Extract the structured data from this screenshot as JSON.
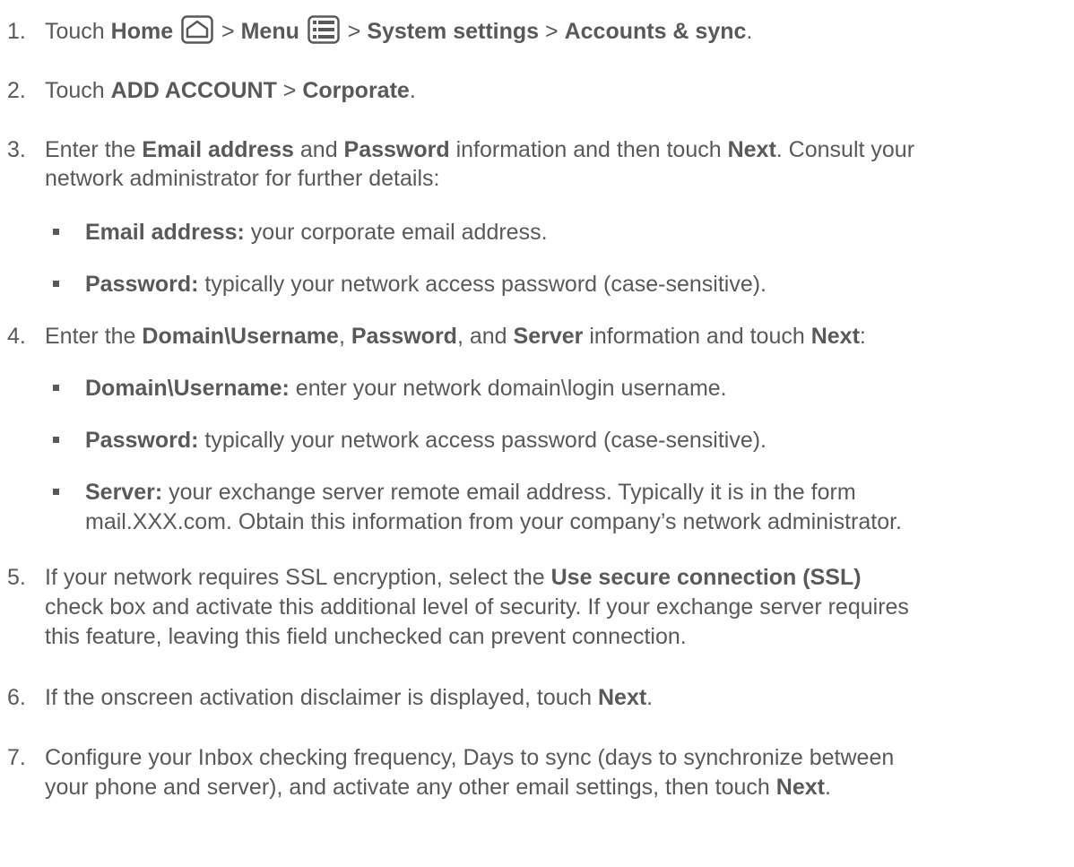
{
  "steps": [
    {
      "num": "1.",
      "parts": [
        {
          "t": "Touch "
        },
        {
          "b": "Home"
        },
        {
          "t": " "
        },
        {
          "icon": "home-icon"
        },
        {
          "t": " > "
        },
        {
          "b": "Menu"
        },
        {
          "t": " "
        },
        {
          "icon": "menu-icon"
        },
        {
          "t": " > "
        },
        {
          "b": "System settings"
        },
        {
          "t": " > "
        },
        {
          "b": "Accounts & sync"
        },
        {
          "t": "."
        }
      ]
    },
    {
      "num": "2.",
      "parts": [
        {
          "t": "Touch "
        },
        {
          "b": "ADD ACCOUNT"
        },
        {
          "t": " > "
        },
        {
          "b": "Corporate"
        },
        {
          "t": "."
        }
      ]
    },
    {
      "num": "3.",
      "lines": [
        [
          {
            "t": "Enter the "
          },
          {
            "b": "Email address"
          },
          {
            "t": " and "
          },
          {
            "b": "Password"
          },
          {
            "t": " information and then touch "
          },
          {
            "b": "Next"
          },
          {
            "t": ". Consult your"
          }
        ],
        [
          {
            "t": "network administrator for further details:"
          }
        ]
      ],
      "subs": [
        [
          {
            "b": "Email address:"
          },
          {
            "t": " your corporate email address."
          }
        ],
        [
          {
            "b": "Password:"
          },
          {
            "t": " typically your network access password (case-sensitive)."
          }
        ]
      ]
    },
    {
      "num": "4.",
      "parts": [
        {
          "t": "Enter the "
        },
        {
          "b": "Domain\\Username"
        },
        {
          "t": ", "
        },
        {
          "b": "Password"
        },
        {
          "t": ", and "
        },
        {
          "b": "Server"
        },
        {
          "t": " information and touch "
        },
        {
          "b": "Next"
        },
        {
          "t": ":"
        }
      ],
      "subs": [
        [
          {
            "b": "Domain\\Username:"
          },
          {
            "t": " enter your network domain\\login username."
          }
        ],
        [
          {
            "b": "Password:"
          },
          {
            "t": " typically your network access password (case-sensitive)."
          }
        ],
        [
          {
            "b": "Server:"
          },
          {
            "t": " your exchange server remote email address. Typically it is in the form"
          }
        ],
        [
          {
            "t": "mail.XXX.com. Obtain this information from your company’s network administrator."
          }
        ]
      ]
    },
    {
      "num": "5.",
      "lines": [
        [
          {
            "t": "If your network requires SSL encryption, select the "
          },
          {
            "b": "Use secure connection (SSL)"
          }
        ],
        [
          {
            "t": "check box and activate this additional level of security. If your exchange server requires"
          }
        ],
        [
          {
            "t": "this feature, leaving this field unchecked can prevent connection."
          }
        ]
      ]
    },
    {
      "num": "6.",
      "parts": [
        {
          "t": "If the onscreen activation disclaimer is displayed, touch "
        },
        {
          "b": "Next"
        },
        {
          "t": "."
        }
      ]
    },
    {
      "num": "7.",
      "lines": [
        [
          {
            "t": "Configure your Inbox checking frequency, Days to sync (days to synchronize between"
          }
        ],
        [
          {
            "t": "your phone and server), and activate any other email settings, then touch "
          },
          {
            "b": "Next"
          },
          {
            "t": "."
          }
        ]
      ]
    }
  ]
}
